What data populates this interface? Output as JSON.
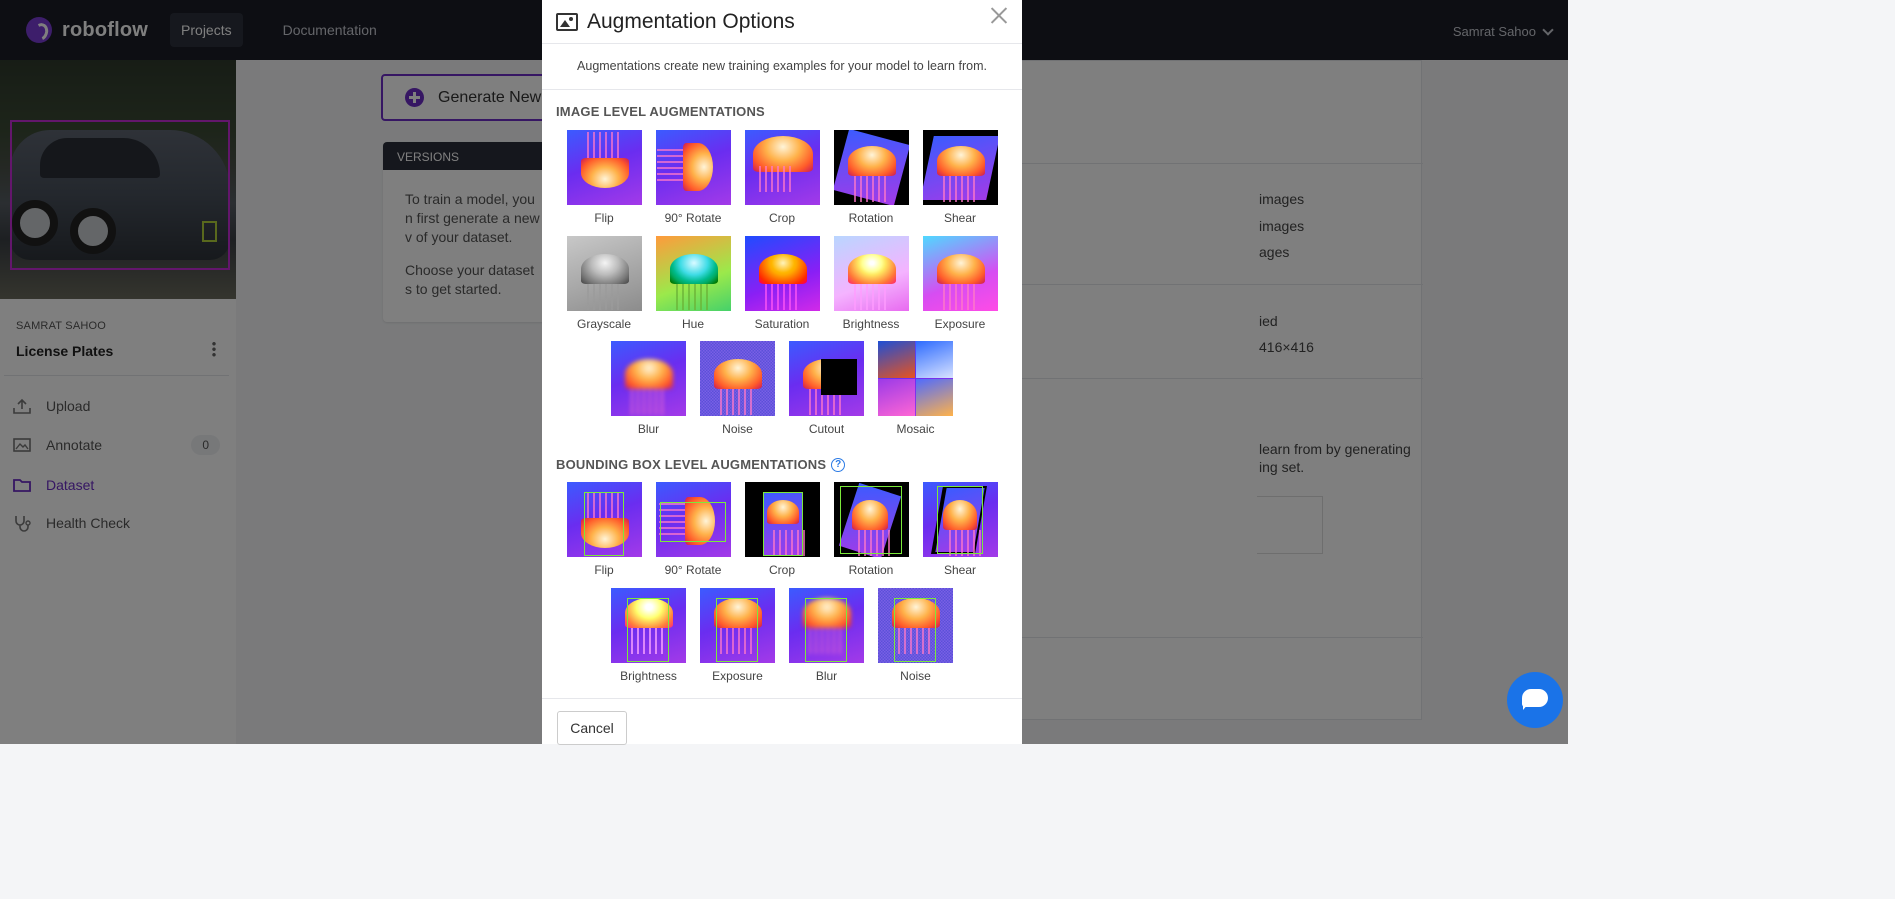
{
  "nav": {
    "brand": "roboflow",
    "links": [
      {
        "label": "Projects",
        "active": true
      },
      {
        "label": "Documentation",
        "active": false
      }
    ],
    "user": "Samrat Sahoo"
  },
  "sidebar": {
    "owner": "SAMRAT SAHOO",
    "project": "License Plates",
    "items": [
      {
        "label": "Upload",
        "icon": "upload-icon"
      },
      {
        "label": "Annotate",
        "icon": "annotate-icon",
        "badge": "0"
      },
      {
        "label": "Dataset",
        "icon": "folder-icon",
        "active": true
      },
      {
        "label": "Health Check",
        "icon": "stethoscope-icon"
      }
    ]
  },
  "main": {
    "generate_button": "Generate New",
    "versions": {
      "header": "VERSIONS",
      "p1": "To train a model, you n first generate a new v of your dataset.",
      "p2": "Choose your dataset s to get started."
    },
    "right_card": {
      "line1": "images",
      "line2": "images",
      "line3": "ages",
      "line4": "ied",
      "line5": "416×416",
      "line6": "learn from by generating",
      "line7": "ing set."
    }
  },
  "modal": {
    "title": "Augmentation Options",
    "description": "Augmentations create new training examples for your model to learn from.",
    "image_level_title": "IMAGE LEVEL AUGMENTATIONS",
    "image_level": [
      "Flip",
      "90° Rotate",
      "Crop",
      "Rotation",
      "Shear",
      "Grayscale",
      "Hue",
      "Saturation",
      "Brightness",
      "Exposure",
      "Blur",
      "Noise",
      "Cutout",
      "Mosaic"
    ],
    "bbox_level_title": "BOUNDING BOX LEVEL AUGMENTATIONS",
    "bbox_level": [
      "Flip",
      "90° Rotate",
      "Crop",
      "Rotation",
      "Shear",
      "Brightness",
      "Exposure",
      "Blur",
      "Noise"
    ],
    "cancel": "Cancel"
  },
  "colors": {
    "accent": "#6c2dc7",
    "nav_bg": "#1a1d26",
    "bbox": "#7bea3a",
    "chat": "#1a73e8"
  }
}
